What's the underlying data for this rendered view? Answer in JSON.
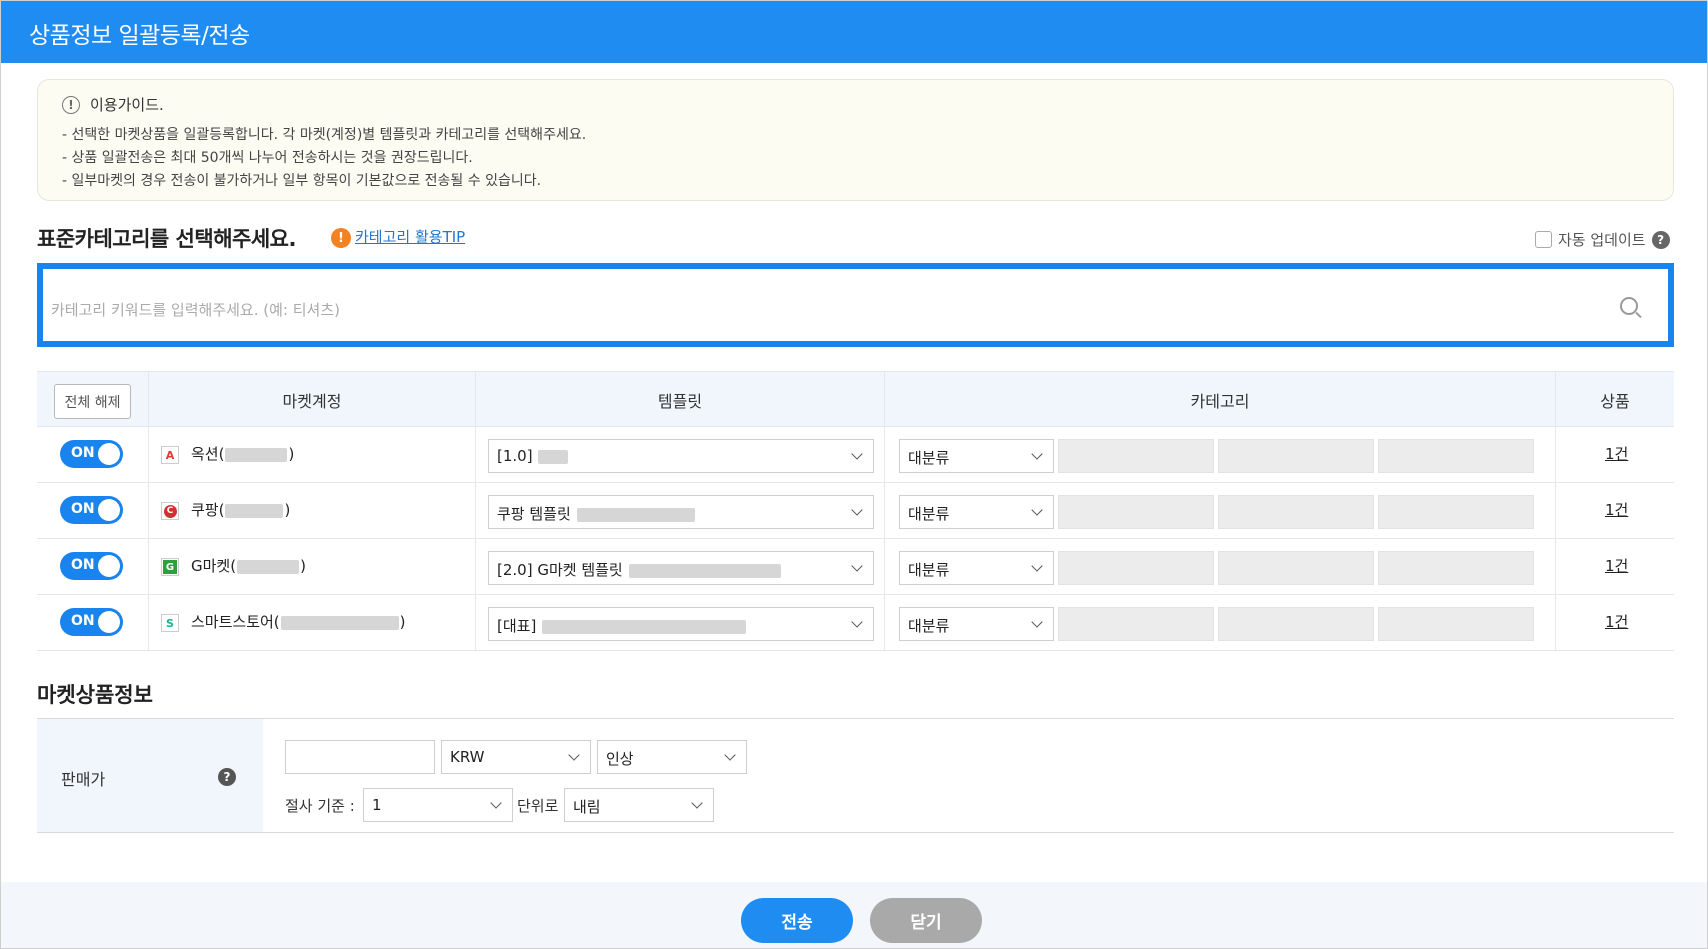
{
  "window": {
    "title": "상품정보 일괄등록/전송"
  },
  "guide": {
    "heading": "이용가이드.",
    "lines": [
      "- 선택한 마켓상품을 일괄등록합니다. 각 마켓(계정)별 템플릿과 카테고리를 선택해주세요.",
      "- 상품 일괄전송은 최대 50개씩 나누어 전송하시는 것을 권장드립니다.",
      "- 일부마켓의 경우 전송이 불가하거나 일부 항목이 기본값으로 전송될 수 있습니다."
    ]
  },
  "category": {
    "heading": "표준카테고리를 선택해주세요.",
    "tip_link": "카테고리 활용TIP",
    "auto_update_label": "자동 업데이트",
    "search_placeholder": "카테고리 키워드를 입력해주세요. (예: 티셔츠)"
  },
  "table": {
    "clear_button": "전체 해제",
    "headers": {
      "market": "마켓계정",
      "template": "템플릿",
      "category": "카테고리",
      "product": "상품"
    },
    "rows": [
      {
        "toggle": "ON",
        "icon_letter": "A",
        "icon_color": "#e53935",
        "market": "옥션(",
        "market_end": ")",
        "template": "[1.0]",
        "category_l1": "대분류",
        "count": "1건"
      },
      {
        "toggle": "ON",
        "icon_letter": "C",
        "icon_color": "#d32f2f",
        "market": "쿠팡(",
        "market_end": ")",
        "template": "쿠팡 템플릿",
        "category_l1": "대분류",
        "count": "1건"
      },
      {
        "toggle": "ON",
        "icon_letter": "G",
        "icon_color": "#2e9e3e",
        "market": "G마켓(",
        "market_end": ")",
        "template": "[2.0] G마켓 템플릿",
        "category_l1": "대분류",
        "count": "1건"
      },
      {
        "toggle": "ON",
        "icon_letter": "S",
        "icon_color": "#19b394",
        "market": "스마트스토어(",
        "market_end": ")",
        "template": "[대표]",
        "category_l1": "대분류",
        "count": "1건"
      }
    ]
  },
  "market_info": {
    "heading": "마켓상품정보",
    "price_label": "판매가",
    "price_value": "",
    "currency": "KRW",
    "adjust": "인상",
    "cut_label": "절사 기준 :",
    "cut_value": "1",
    "unit_label": "단위로",
    "round_mode": "내림"
  },
  "footer": {
    "send": "전송",
    "close": "닫기"
  },
  "colors": {
    "accent": "#1f8cf2",
    "header_bg": "#f0f6fc",
    "toggle_on": "#1a84ee"
  }
}
